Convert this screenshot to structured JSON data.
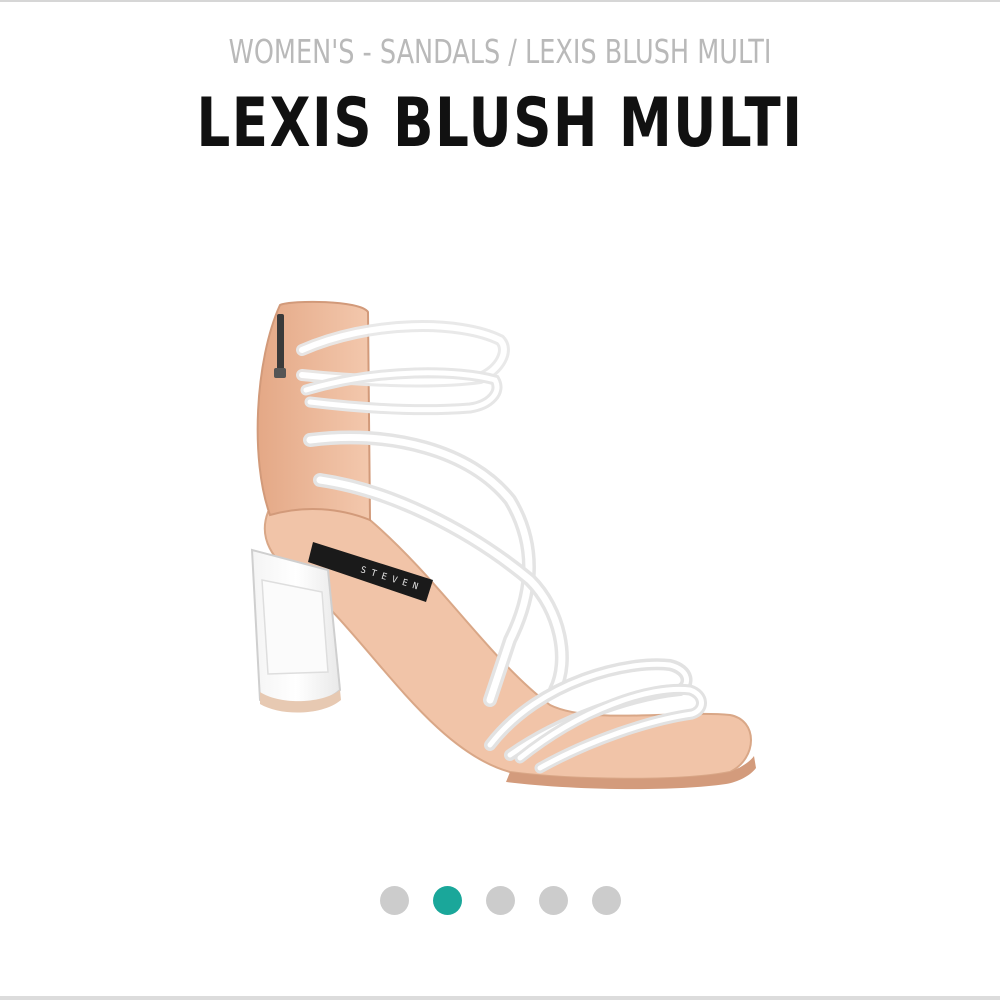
{
  "breadcrumb": {
    "category": "WOMEN'S - SANDALS",
    "separator": " / ",
    "current": "LEXIS BLUSH MULTI"
  },
  "product": {
    "title": "LEXIS BLUSH MULTI",
    "image_alt": "Clear strappy block-heel sandal in blush"
  },
  "carousel": {
    "slide_count": 5,
    "active_index": 1,
    "active_color": "#1aa79a",
    "inactive_color": "#cccccc"
  },
  "colors": {
    "breadcrumb_text": "#b9b9b9",
    "title_text": "#111111",
    "sandal_blush": "#eab99a"
  }
}
